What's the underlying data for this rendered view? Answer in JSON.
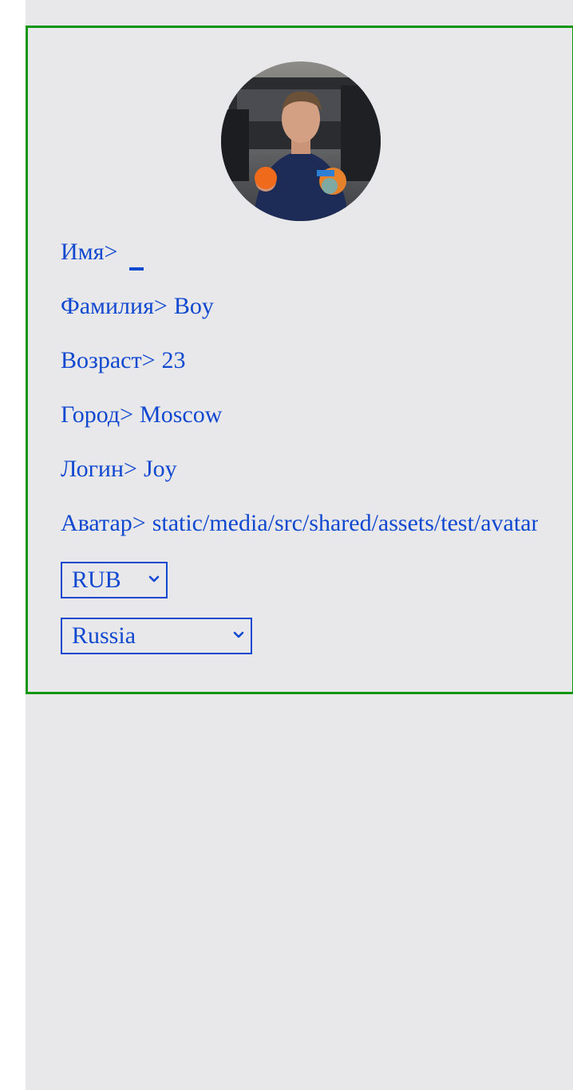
{
  "profile": {
    "avatar_alt": "avatar",
    "fields": {
      "first_name": {
        "label": "Имя>",
        "value": ""
      },
      "last_name": {
        "label": "Фамилия>",
        "value": "Boy"
      },
      "age": {
        "label": "Возраст>",
        "value": "23"
      },
      "city": {
        "label": "Город>",
        "value": "Moscow"
      },
      "login": {
        "label": "Логин>",
        "value": "Joy"
      },
      "avatar": {
        "label": "Аватар>",
        "value": "static/media/src/shared/assets/test/avatar.jpg"
      }
    },
    "currency": {
      "selected": "RUB"
    },
    "country": {
      "selected": "Russia"
    }
  },
  "colors": {
    "text": "#1148d0",
    "card_border": "#129512",
    "background": "#e8e8ea"
  },
  "icons": {
    "chevron": "chevron-down-icon"
  }
}
